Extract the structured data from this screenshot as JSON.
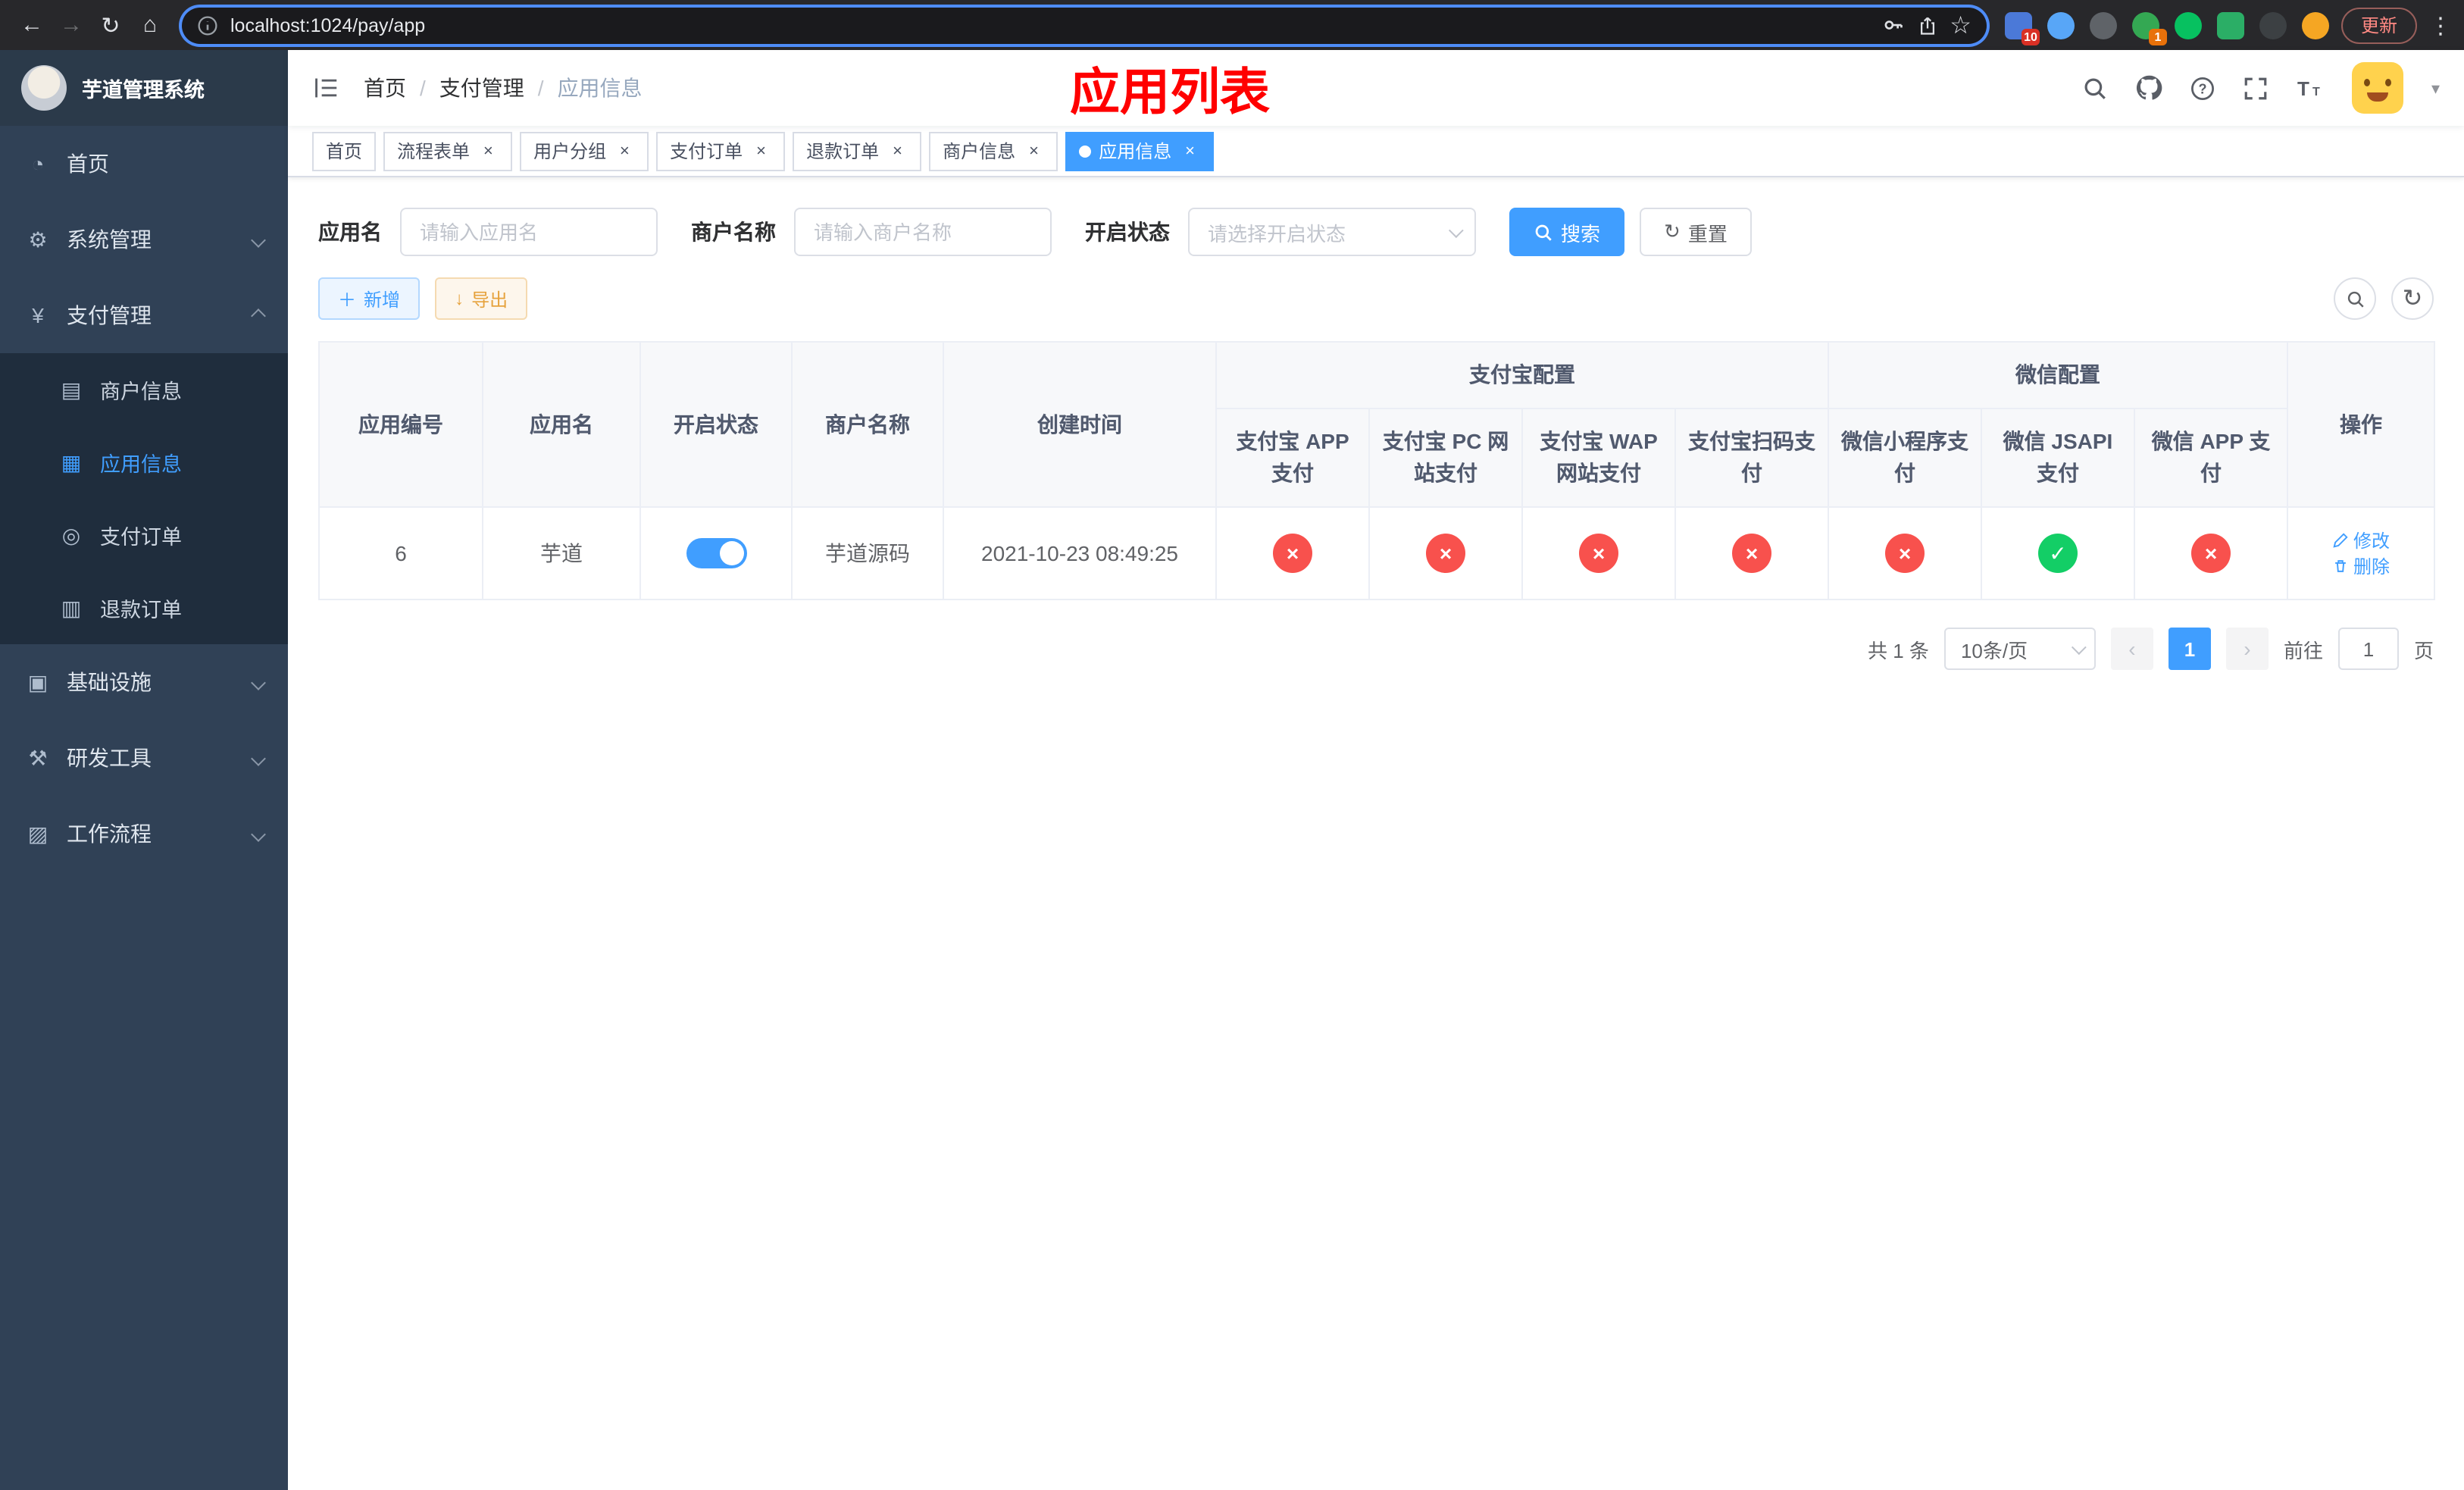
{
  "colors": {
    "accent": "#409EFF",
    "danger": "#F8514D",
    "success": "#13CE66"
  },
  "browser": {
    "url": "localhost:1024/pay/app",
    "update": "更新",
    "extensions": [
      {
        "color": "#4b79d8",
        "badge": "10",
        "badge_color": "#d93025"
      },
      {
        "color": "#58a6f7"
      },
      {
        "color": "#5f6368"
      },
      {
        "color": "#34a853",
        "badge": "1",
        "badge_color": "#e8710a"
      },
      {
        "color": "#07c160"
      },
      {
        "color": "#2bae66"
      },
      {
        "color": "#3c4043"
      },
      {
        "color": "#f5a623"
      }
    ]
  },
  "sidebar": {
    "title": "芋道管理系统",
    "items": [
      {
        "label": "首页",
        "icon": "dashboard-icon"
      },
      {
        "label": "系统管理",
        "icon": "gear-icon"
      },
      {
        "label": "支付管理",
        "icon": "yen-icon",
        "children": [
          {
            "label": "商户信息",
            "icon": "card-icon"
          },
          {
            "label": "应用信息",
            "icon": "grid-icon",
            "active": true
          },
          {
            "label": "支付订单",
            "icon": "order-icon"
          },
          {
            "label": "退款订单",
            "icon": "refund-icon"
          }
        ]
      },
      {
        "label": "基础设施",
        "icon": "infra-icon"
      },
      {
        "label": "研发工具",
        "icon": "tools-icon"
      },
      {
        "label": "工作流程",
        "icon": "workflow-icon"
      }
    ]
  },
  "navbar": {
    "breadcrumb": [
      "首页",
      "支付管理",
      "应用信息"
    ],
    "annotation": "应用列表"
  },
  "tabs": [
    {
      "label": "首页"
    },
    {
      "label": "流程表单"
    },
    {
      "label": "用户分组"
    },
    {
      "label": "支付订单"
    },
    {
      "label": "退款订单"
    },
    {
      "label": "商户信息"
    },
    {
      "label": "应用信息",
      "active": true
    }
  ],
  "filters": {
    "app_name": {
      "label": "应用名",
      "placeholder": "请输入应用名",
      "value": ""
    },
    "merchant_name": {
      "label": "商户名称",
      "placeholder": "请输入商户名称",
      "value": ""
    },
    "status": {
      "label": "开启状态",
      "placeholder": "请选择开启状态"
    },
    "search": "搜索",
    "reset": "重置"
  },
  "toolbar": {
    "add": "新增",
    "export": "导出"
  },
  "table": {
    "headers": {
      "app_id": "应用编号",
      "app_name": "应用名",
      "status": "开启状态",
      "merchant": "商户名称",
      "created": "创建时间",
      "alipay_group": "支付宝配置",
      "wechat_group": "微信配置",
      "alipay_app": "支付宝 APP 支付",
      "alipay_pc": "支付宝 PC 网站支付",
      "alipay_wap": "支付宝 WAP 网站支付",
      "alipay_qr": "支付宝扫码支付",
      "wx_mini": "微信小程序支付",
      "wx_jsapi": "微信 JSAPI 支付",
      "wx_app": "微信 APP 支付",
      "actions": "操作"
    },
    "rows": [
      {
        "app_id": "6",
        "app_name": "芋道",
        "status_on": true,
        "merchant": "芋道源码",
        "created": "2021-10-23 08:49:25",
        "configs": {
          "alipay_app": false,
          "alipay_pc": false,
          "alipay_wap": false,
          "alipay_qr": false,
          "wx_mini": false,
          "wx_jsapi": true,
          "wx_app": false
        },
        "edit": "修改",
        "delete": "删除"
      }
    ]
  },
  "pagination": {
    "total": "共 1 条",
    "page_size": "10条/页",
    "current_page": "1",
    "goto": "前往",
    "goto_value": "1",
    "page_unit": "页"
  }
}
